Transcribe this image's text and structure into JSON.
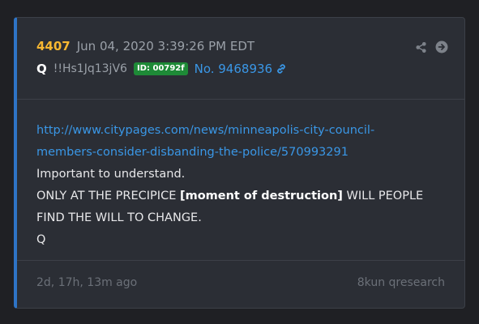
{
  "post": {
    "number": "4407",
    "timestamp": "Jun 04, 2020 3:39:26 PM EDT",
    "author": "Q",
    "tripcode": "!!Hs1Jq13jV6",
    "id_badge": "ID: 00792f",
    "post_link": "No. 9468936",
    "icons": [
      "share-icon",
      "arrow-right-circle-icon",
      "link-icon"
    ],
    "colors": {
      "number": "#f7b731",
      "link": "#3a97e6",
      "badge": "#1e8a37",
      "accent_border": "#2e74c6"
    }
  },
  "body": {
    "url_line1": "http://www.citypages.com/news/minneapolis-city-council-",
    "url_line2": "members-consider-disbanding-the-police/570993291",
    "line1": "Important to understand.",
    "line2_start": "ONLY AT THE PRECIPICE ",
    "line2_bold": "[moment of destruction]",
    "line2_end": " WILL PEOPLE",
    "line3": "FIND THE WILL TO CHANGE.",
    "signature": "Q"
  },
  "footer": {
    "age": "2d, 17h, 13m ago",
    "source": "8kun qresearch"
  }
}
